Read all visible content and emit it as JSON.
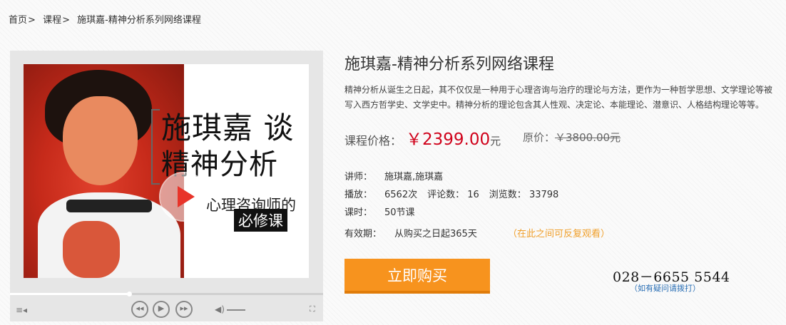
{
  "breadcrumb": {
    "home": "首页",
    "courses": "课程",
    "current": "施琪嘉-精神分析系列网络课程",
    "separator": ">"
  },
  "player": {
    "poster": {
      "line1": "施琪嘉 谈",
      "line2": "精神分析",
      "line3": "心理咨询师的",
      "line4": "必修课"
    },
    "progress_fraction": 0.38,
    "icons": {
      "playlist": "list-icon",
      "prev": "prev-icon",
      "play": "play-icon",
      "next": "next-icon",
      "volume": "volume-icon",
      "fullscreen": "fullscreen-icon"
    }
  },
  "course": {
    "title": "施琪嘉-精神分析系列网络课程",
    "description": "精神分析从诞生之日起，其不仅仅是一种用于心理咨询与治疗的理论与方法，更作为一种哲学思想、文学理论等被写入西方哲学史、文学史中。精神分析的理论包含其人性观、决定论、本能理论、潜意识、人格结构理论等等。",
    "price_label": "课程价格：",
    "price": "￥2399.00",
    "price_unit": "元",
    "original_label": "原价：",
    "original_price": "￥3800.00元",
    "teacher_label": "讲师：",
    "teacher": "施琪嘉,施琪嘉",
    "plays_label": "播放：",
    "plays": "6562次",
    "comments_label": "评论数：",
    "comments": "16",
    "views_label": "浏览数：",
    "views": "33798",
    "hours_label": "课时：",
    "hours": "50节课",
    "valid_label": "有效期：",
    "valid": "从购买之日起365天",
    "valid_hint": "（在此之间可反复观看）",
    "buy_label": "立即购买",
    "phone": "028－6655 5544",
    "phone_hint": "（如有疑问请拨打）"
  },
  "colors": {
    "price": "#d0021b",
    "buy_button": "#f7931e",
    "hint_orange": "#f0a02c",
    "hint_blue": "#2a6fb5"
  }
}
